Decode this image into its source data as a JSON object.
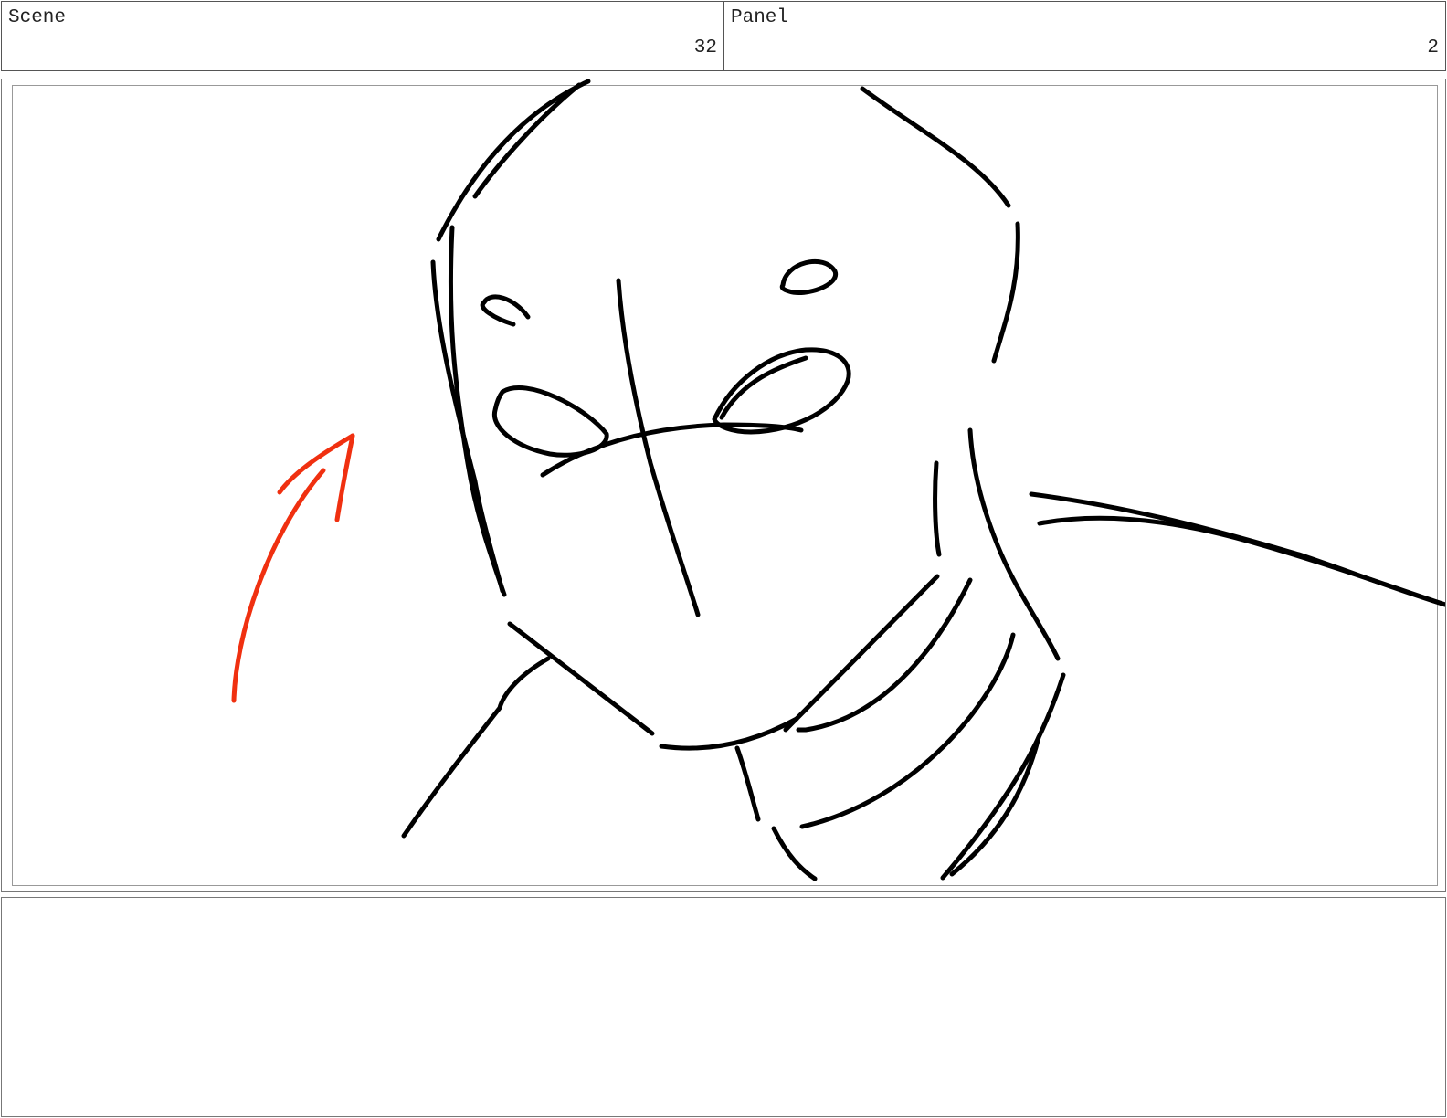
{
  "header": {
    "scene_label": "Scene",
    "scene_number": "32",
    "panel_label": "Panel",
    "panel_number": "2"
  },
  "sketch": {
    "line_color": "#000000",
    "arrow_color": "#f03010",
    "subject": "rough pencil storyboard drawing of a face with a red direction arrow"
  },
  "notes": {
    "text": ""
  }
}
